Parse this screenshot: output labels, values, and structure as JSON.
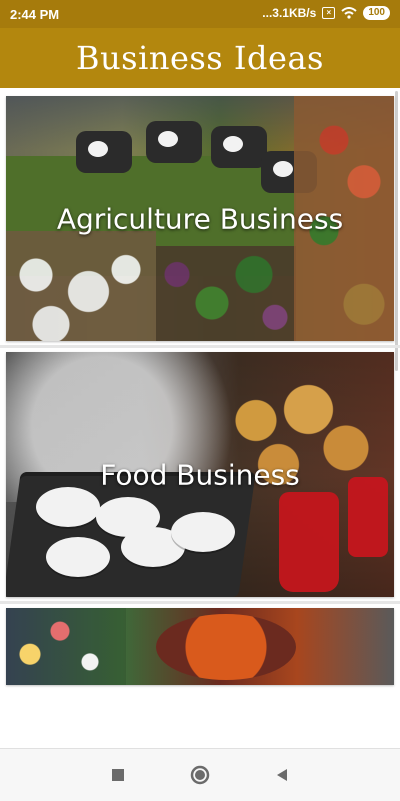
{
  "status_bar": {
    "time": "2:44 PM",
    "network_speed": "...3.1KB/s",
    "battery": "100"
  },
  "app_bar": {
    "title": "Business Ideas"
  },
  "cards": [
    {
      "label": "Agriculture Business"
    },
    {
      "label": "Food Business"
    },
    {
      "label": ""
    }
  ],
  "colors": {
    "status_bar": "#a67b0c",
    "app_bar": "#b3870e",
    "nav_bar": "#f7f7f7"
  },
  "nav_bar": {
    "icons": [
      "recent-apps-square-icon",
      "home-circle-icon",
      "back-triangle-icon"
    ]
  }
}
